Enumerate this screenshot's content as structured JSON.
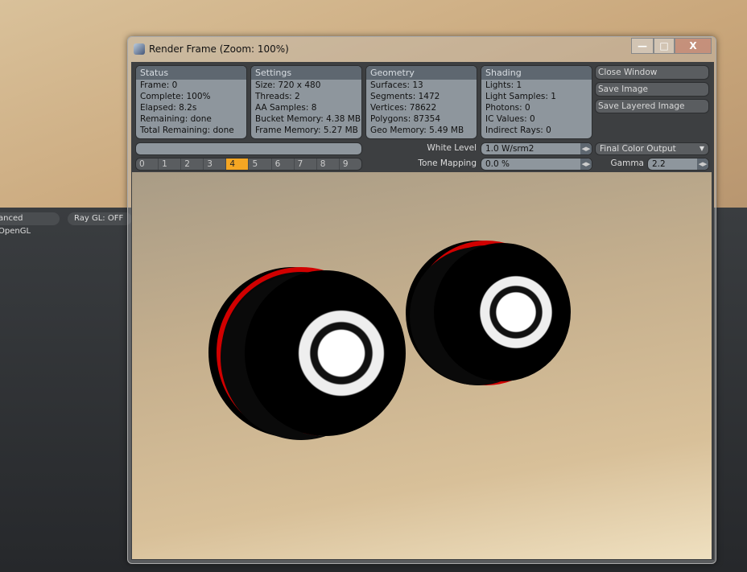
{
  "background": {
    "viewport_buttons": [
      "anced OpenGL",
      "Ray GL: OFF"
    ]
  },
  "window": {
    "title": "Render Frame (Zoom: 100%)",
    "controls": [
      "minimize",
      "maximize",
      "close"
    ]
  },
  "panels": [
    {
      "title": "Status",
      "lines": [
        "Frame: 0",
        "Complete: 100%",
        "Elapsed: 8.2s",
        "Remaining: done",
        "Total Remaining: done"
      ]
    },
    {
      "title": "Settings",
      "lines": [
        "Size: 720 x 480",
        "Threads: 2",
        "AA Samples: 8",
        "Bucket Memory: 4.38 MB",
        "Frame Memory: 5.27 MB"
      ]
    },
    {
      "title": "Geometry",
      "lines": [
        "Surfaces: 13",
        "Segments: 1472",
        "Vertices: 78622",
        "Polygons: 87354",
        "Geo Memory: 5.49 MB"
      ]
    },
    {
      "title": "Shading",
      "lines": [
        "Lights: 1",
        "Light Samples: 1",
        "Photons: 0",
        "IC Values: 0",
        "Indirect Rays: 0"
      ]
    }
  ],
  "buttons": {
    "close": "Close Window",
    "save": "Save Image",
    "save_layered": "Save Layered Image"
  },
  "controls": {
    "white_level_label": "White Level",
    "white_level": "1.0 W/srm2",
    "tone_mapping_label": "Tone Mapping",
    "tone_mapping": "0.0 %",
    "output": "Final Color Output",
    "gamma_label": "Gamma",
    "gamma": "2.2"
  },
  "progress": 1.0,
  "frames": [
    "0",
    "1",
    "2",
    "3",
    "4",
    "5",
    "6",
    "7",
    "8",
    "9"
  ],
  "selected_frame": "4",
  "colors": {
    "accent": "#f5a623",
    "panel": "#8e969d",
    "header": "#5e6770"
  }
}
